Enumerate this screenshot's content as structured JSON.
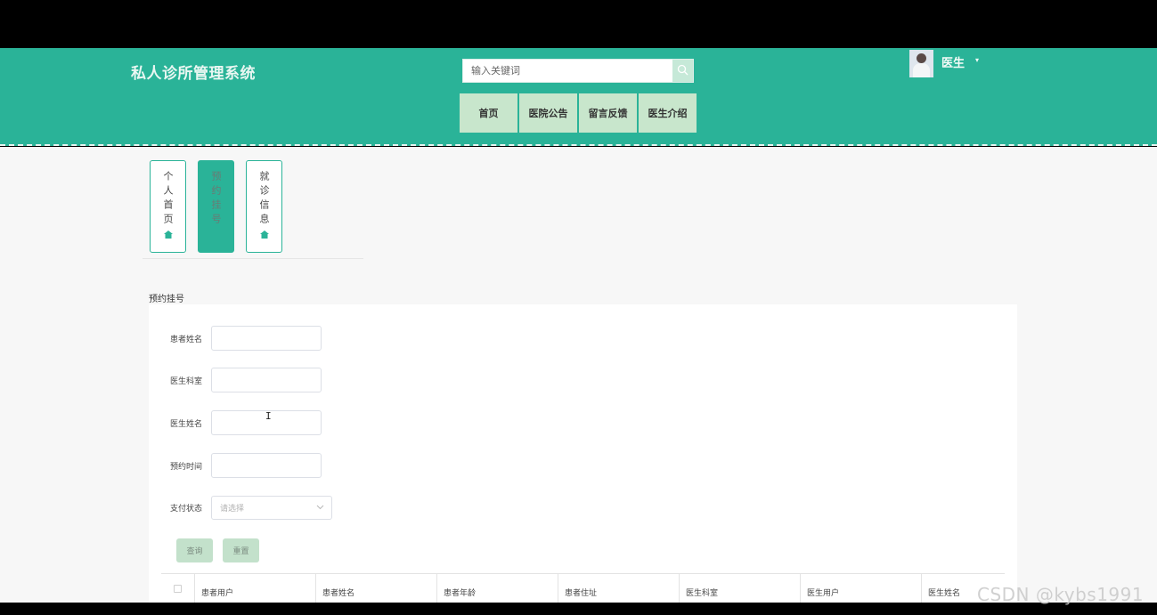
{
  "header": {
    "app_title": "私人诊所管理系统",
    "search": {
      "placeholder": "输入关键词",
      "value": ""
    },
    "nav": [
      {
        "label": "首页"
      },
      {
        "label": "医院公告"
      },
      {
        "label": "留言反馈"
      },
      {
        "label": "医生介绍"
      }
    ],
    "user": {
      "name": "医生",
      "caret": "▾"
    }
  },
  "side_tabs": [
    {
      "label": "个人首页",
      "icon": "home-icon",
      "active": false
    },
    {
      "label": "预约挂号",
      "active": true
    },
    {
      "label": "就诊信息",
      "icon": "home-icon",
      "active": false
    }
  ],
  "section_title": "预约挂号",
  "form": {
    "fields": [
      {
        "label": "患者姓名",
        "value": ""
      },
      {
        "label": "医生科室",
        "value": ""
      },
      {
        "label": "医生姓名",
        "value": ""
      },
      {
        "label": "预约时间",
        "value": ""
      }
    ],
    "pay_status": {
      "label": "支付状态",
      "placeholder": "请选择"
    },
    "query_label": "查询",
    "reset_label": "重置"
  },
  "table": {
    "columns": [
      "患者用户",
      "患者姓名",
      "患者年龄",
      "患者住址",
      "医生科室",
      "医生用户",
      "医生姓名"
    ]
  },
  "watermark": "CSDN @kybs1991",
  "colors": {
    "brand": "#2ab398",
    "nav_bg": "#c8e6cc",
    "button_bg": "#c3e1cb"
  }
}
